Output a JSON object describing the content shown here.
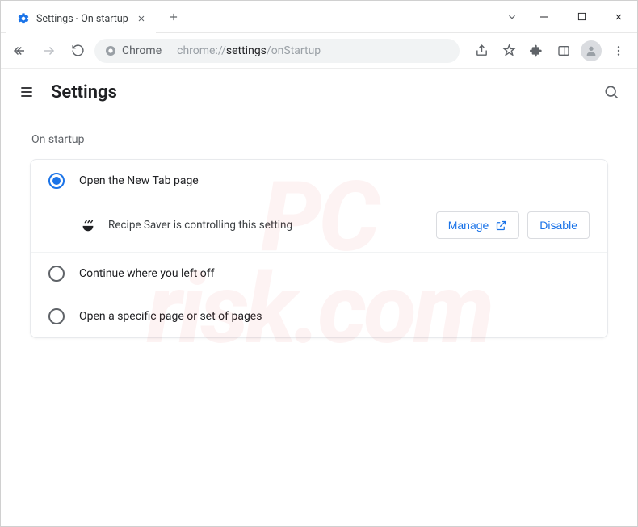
{
  "tab": {
    "title": "Settings - On startup"
  },
  "omnibox": {
    "chip": "Chrome",
    "url_prefix": "chrome://",
    "url_highlight": "settings",
    "url_suffix": "/onStartup"
  },
  "settings": {
    "title": "Settings"
  },
  "section": {
    "label": "On startup",
    "options": {
      "new_tab": "Open the New Tab page",
      "continue": "Continue where you left off",
      "specific": "Open a specific page or set of pages"
    },
    "controlled_by": {
      "text": "Recipe Saver is controlling this setting",
      "manage": "Manage",
      "disable": "Disable"
    }
  },
  "watermark": "PC\nrisk.com"
}
